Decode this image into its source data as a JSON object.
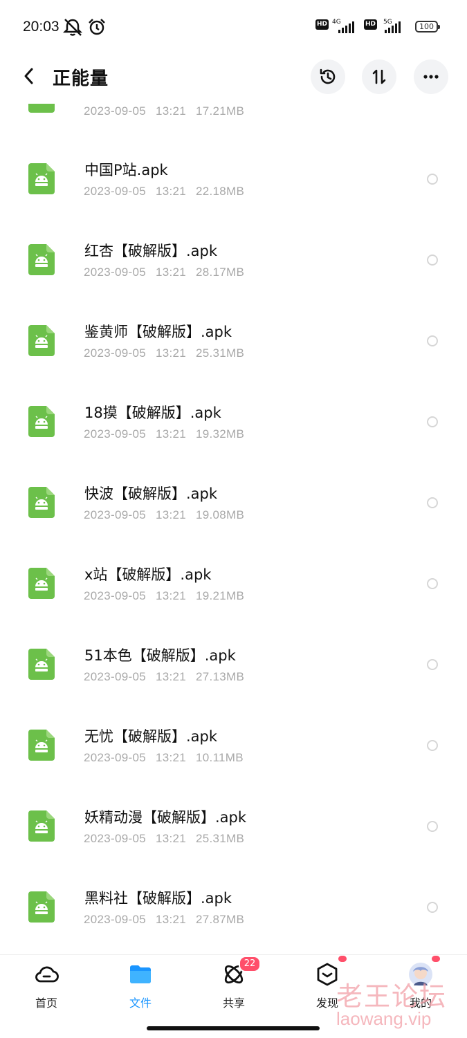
{
  "status_bar": {
    "time": "20:03",
    "network1": "4G",
    "network2": "5G",
    "hd": "HD",
    "battery": "100"
  },
  "header": {
    "title": "正能量"
  },
  "partial_row": {
    "date": "2023-09-05",
    "time": "13:21",
    "size": "17.21MB"
  },
  "files": [
    {
      "name": "中国P站.apk",
      "date": "2023-09-05",
      "time": "13:21",
      "size": "22.18MB"
    },
    {
      "name": "红杏【破解版】.apk",
      "date": "2023-09-05",
      "time": "13:21",
      "size": "28.17MB"
    },
    {
      "name": "鉴黄师【破解版】.apk",
      "date": "2023-09-05",
      "time": "13:21",
      "size": "25.31MB"
    },
    {
      "name": "18摸【破解版】.apk",
      "date": "2023-09-05",
      "time": "13:21",
      "size": "19.32MB"
    },
    {
      "name": "快波【破解版】.apk",
      "date": "2023-09-05",
      "time": "13:21",
      "size": "19.08MB"
    },
    {
      "name": "x站【破解版】.apk",
      "date": "2023-09-05",
      "time": "13:21",
      "size": "19.21MB"
    },
    {
      "name": "51本色【破解版】.apk",
      "date": "2023-09-05",
      "time": "13:21",
      "size": "27.13MB"
    },
    {
      "name": "无忧【破解版】.apk",
      "date": "2023-09-05",
      "time": "13:21",
      "size": "10.11MB"
    },
    {
      "name": "妖精动漫【破解版】.apk",
      "date": "2023-09-05",
      "time": "13:21",
      "size": "25.31MB"
    },
    {
      "name": "黑料社【破解版】.apk",
      "date": "2023-09-05",
      "time": "13:21",
      "size": "27.87MB"
    }
  ],
  "bottom_nav": {
    "items": [
      {
        "label": "首页",
        "icon": "cloud-icon"
      },
      {
        "label": "文件",
        "icon": "folder-icon"
      },
      {
        "label": "共享",
        "icon": "share-orbit-icon",
        "badge": "22"
      },
      {
        "label": "发现",
        "icon": "discover-box-icon"
      },
      {
        "label": "我的",
        "icon": "avatar"
      }
    ],
    "active_index": 1
  },
  "watermark": {
    "line1": "老王论坛",
    "line2": "laowang.vip"
  },
  "colors": {
    "accent": "#1a95ff",
    "apk_green": "#6cc04a",
    "badge": "#ff4f6a",
    "meta_gray": "#a8a8a8"
  }
}
